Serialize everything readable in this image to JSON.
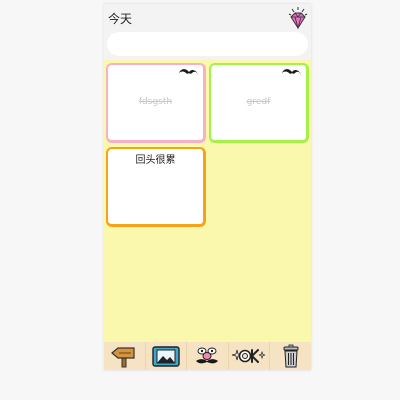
{
  "header": {
    "title": "今天",
    "diamond_icon": "diamond-icon",
    "search_placeholder": ""
  },
  "board": {
    "background": "#faf8ad",
    "notes": [
      {
        "text": "fdsgsth",
        "border_color": "#f6b1c6",
        "completed": true,
        "pin_icon": "mustache-icon"
      },
      {
        "text": "gredf",
        "border_color": "#a4f14a",
        "completed": true,
        "pin_icon": "mustache-icon"
      },
      {
        "text": "回头很累",
        "border_color": "#f6a21d",
        "completed": false
      }
    ]
  },
  "toolbar": {
    "items": [
      {
        "icon": "back-signpost-icon"
      },
      {
        "icon": "photo-frame-icon"
      },
      {
        "icon": "funny-face-icon"
      },
      {
        "icon": "ok-sparkle-icon"
      },
      {
        "icon": "trash-icon"
      }
    ]
  }
}
